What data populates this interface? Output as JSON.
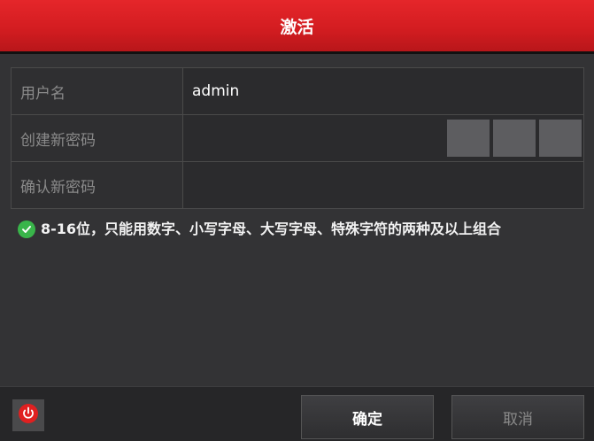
{
  "window": {
    "title": "激活"
  },
  "form": {
    "rows": [
      {
        "label": "用户名",
        "value": "admin"
      },
      {
        "label": "创建新密码",
        "value": ""
      },
      {
        "label": "确认新密码",
        "value": ""
      }
    ],
    "password_strength_segments": 3
  },
  "hint": {
    "icon": "check-circle-icon",
    "text": "8-16位，只能用数字、小写字母、大写字母、特殊字符的两种及以上组合"
  },
  "footer": {
    "power_icon": "power-icon",
    "ok_label": "确定",
    "cancel_label": "取消"
  },
  "colors": {
    "title_bar": "#d41d21",
    "check": "#39b54a",
    "power": "#e02020"
  }
}
